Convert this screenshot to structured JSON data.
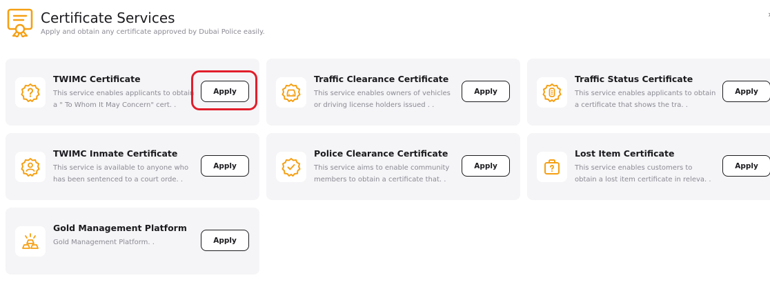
{
  "header": {
    "title": "Certificate Services",
    "subtitle": "Apply and obtain any certificate approved by Dubai Police easily."
  },
  "colors": {
    "accent": "#f59f12",
    "card_bg": "#f5f5f7",
    "highlight": "#e11d2a"
  },
  "services": [
    {
      "title": "TWIMC Certificate",
      "description": "This service enables applicants to obtain a \" To Whom It May Concern\" cert. .",
      "icon": "question-badge-icon",
      "apply_label": "Apply"
    },
    {
      "title": "Traffic Clearance Certificate",
      "description": "This service enables owners of vehicles or driving license holders issued . .",
      "icon": "car-badge-icon",
      "apply_label": "Apply"
    },
    {
      "title": "Traffic Status Certificate",
      "description": "This service enables applicants to obtain a certificate that shows the tra. .",
      "icon": "traffic-light-badge-icon",
      "apply_label": "Apply"
    },
    {
      "title": "TWIMC Inmate Certificate",
      "description": "This service is available to anyone who has been sentenced to a court orde. .",
      "icon": "person-badge-icon",
      "apply_label": "Apply"
    },
    {
      "title": "Police Clearance Certificate",
      "description": "This service aims to enable community members to obtain a certificate that. .",
      "icon": "check-badge-icon",
      "apply_label": "Apply"
    },
    {
      "title": "Lost Item Certificate",
      "description": "This service enables customers to obtain a lost item certificate in releva. .",
      "icon": "lost-bag-icon",
      "apply_label": "Apply"
    },
    {
      "title": "Gold Management Platform",
      "description": "Gold Management Platform. .",
      "icon": "gold-bars-icon",
      "apply_label": "Apply"
    }
  ]
}
